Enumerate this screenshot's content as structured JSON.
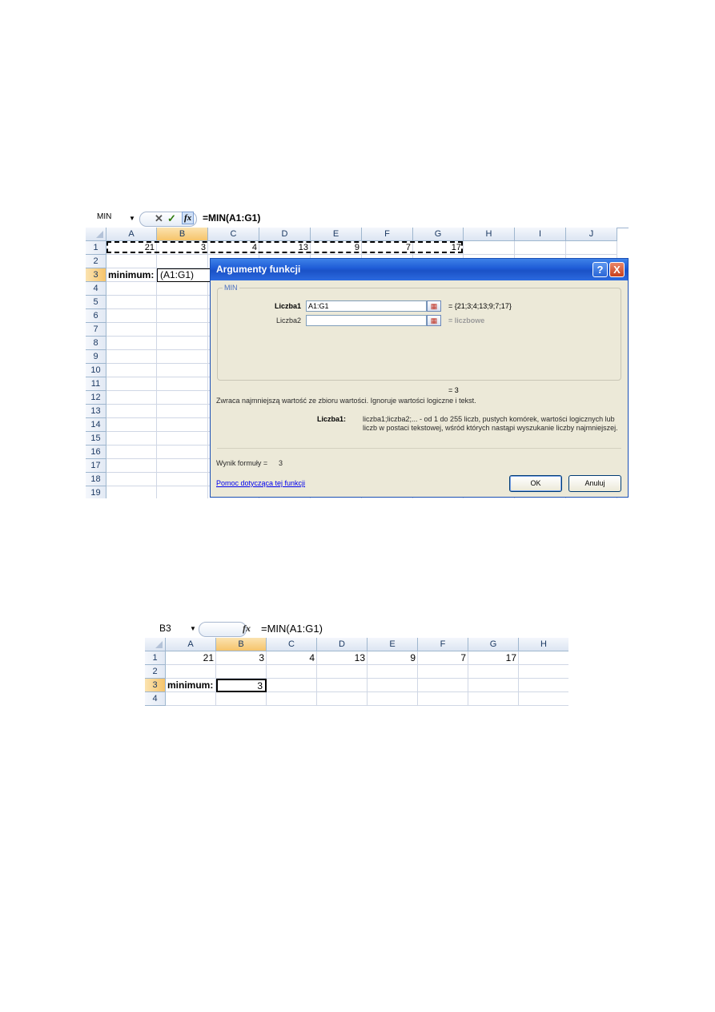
{
  "screenshot1": {
    "namebox": "MIN",
    "formula": "=MIN(A1:G1)",
    "fx_label": "fx",
    "cancel_icon": "cancel-icon",
    "enter_icon": "enter-icon",
    "columns": [
      "A",
      "B",
      "C",
      "D",
      "E",
      "F",
      "G",
      "H",
      "I",
      "J"
    ],
    "rows": [
      "1",
      "2",
      "3",
      "4",
      "5",
      "6",
      "7",
      "8",
      "9",
      "10",
      "11",
      "12",
      "13",
      "14",
      "15",
      "16",
      "17",
      "18",
      "19"
    ],
    "row1_values": [
      "21",
      "3",
      "4",
      "13",
      "9",
      "7",
      "17"
    ],
    "label_minimum": "minimum:",
    "editing_text": "(A1:G1)"
  },
  "dialog": {
    "title": "Argumenty funkcji",
    "help_button": "?",
    "close_button": "X",
    "group_label": "MIN",
    "arg1_label": "Liczba1",
    "arg1_value": "A1:G1",
    "arg1_result": "=  {21;3;4;13;9;7;17}",
    "arg2_label": "Liczba2",
    "arg2_value": "",
    "arg2_result": "=  liczbowe",
    "result_line": "=  3",
    "description": "Zwraca najmniejszą wartość ze zbioru wartości. Ignoruje wartości logiczne i tekst.",
    "param_name": "Liczba1:",
    "param_desc": "liczba1;liczba2;... - od 1 do 255 liczb, pustych komórek, wartości logicznych lub liczb w postaci tekstowej, wśród których nastąpi wyszukanie liczby najmniejszej.",
    "formula_result_label": "Wynik formuły =",
    "formula_result_value": "3",
    "help_link": "Pomoc dotycząca tej funkcji",
    "ok_button": "OK",
    "cancel_button": "Anuluj"
  },
  "screenshot2": {
    "namebox": "B3",
    "formula": "=MIN(A1:G1)",
    "fx_label": "fx",
    "columns": [
      "A",
      "B",
      "C",
      "D",
      "E",
      "F",
      "G",
      "H"
    ],
    "rows": [
      "1",
      "2",
      "3",
      "4"
    ],
    "row1_values": [
      "21",
      "3",
      "4",
      "13",
      "9",
      "7",
      "17"
    ],
    "label_minimum": "minimum:",
    "result_value": "3"
  }
}
